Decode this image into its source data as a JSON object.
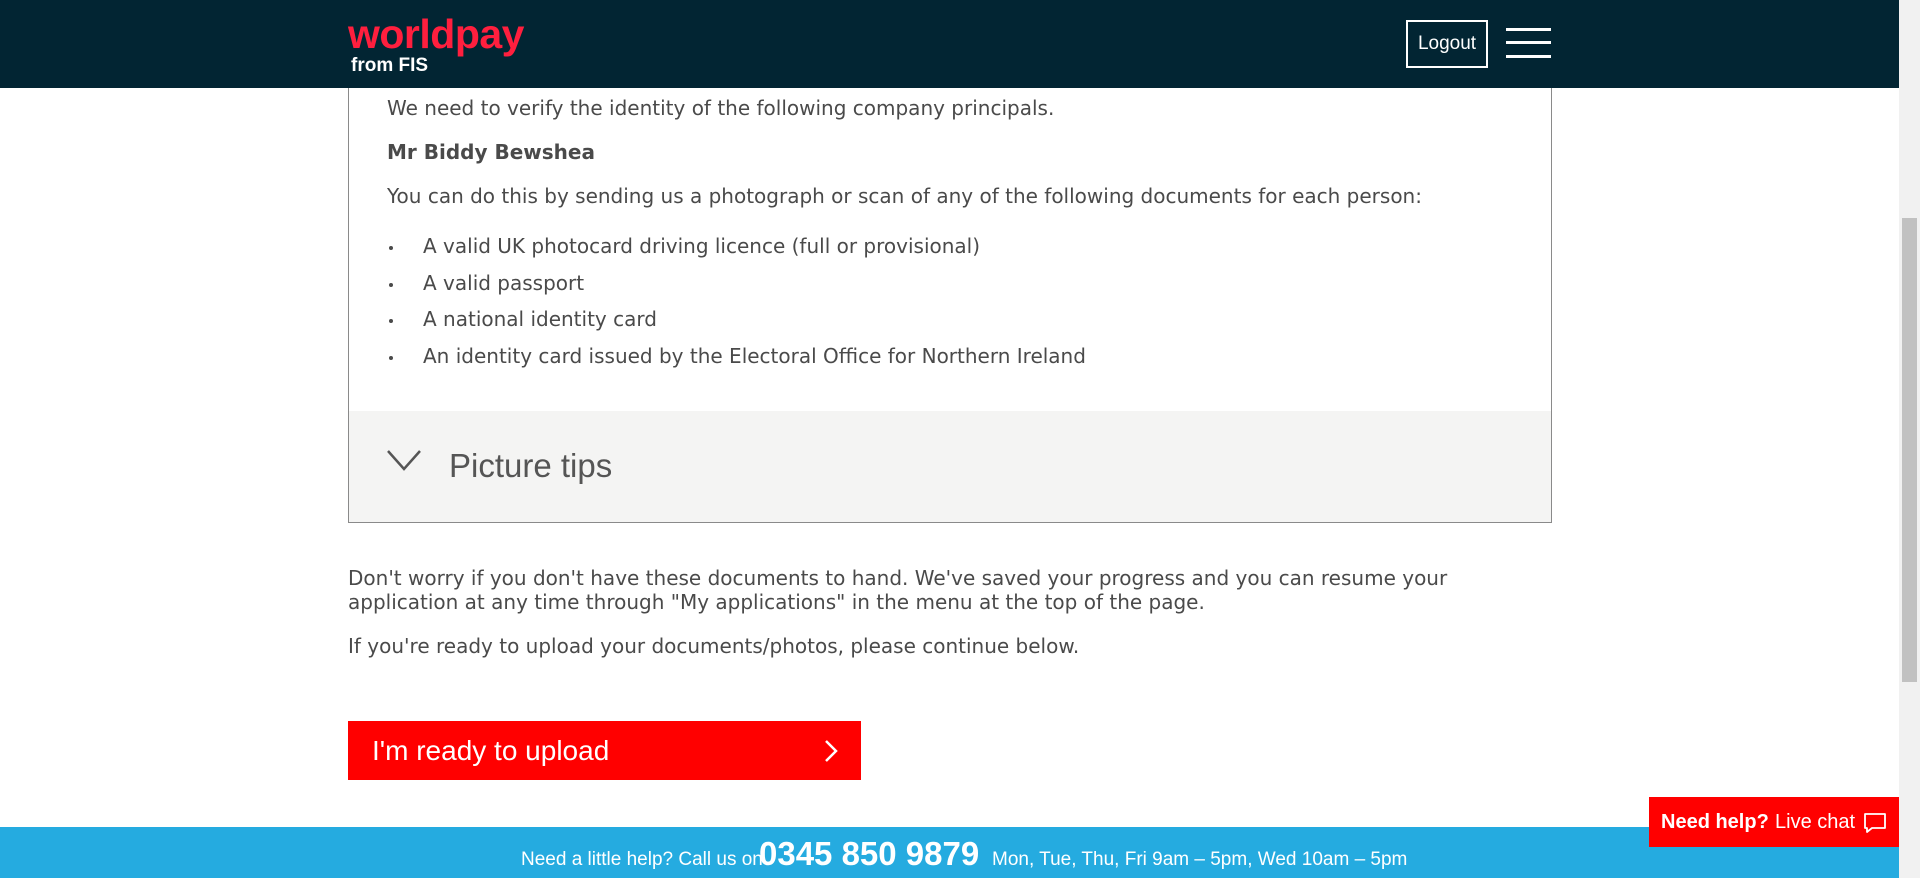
{
  "header": {
    "logo_main": "worldpay",
    "logo_sub": "from FIS",
    "logout_label": "Logout"
  },
  "verification": {
    "intro": "We need to verify the identity of the following company principals.",
    "person_name": "Mr Biddy Bewshea",
    "instruction": "You can do this by sending us a photograph or scan of any of the following documents for each person:",
    "documents": [
      "A valid UK photocard driving licence (full or provisional)",
      "A valid passport",
      "A national identity card",
      "An identity card issued by the Electoral Office for Northern Ireland"
    ],
    "tips_label": "Picture tips"
  },
  "main": {
    "note": "Don't worry if you don't have these documents to hand. We've saved your progress and you can resume your application at any time through \"My applications\" in the menu at the top of the page.",
    "ready_text": "If you're ready to upload your documents/photos, please continue below.",
    "upload_button_label": "I'm ready to upload"
  },
  "chat": {
    "strong_label": "Need help?",
    "label": "Live chat"
  },
  "help_bar": {
    "lead": "Need a little help? Call us on",
    "phone": "0345 850 9879",
    "hours": "Mon, Tue, Thu, Fri 9am – 5pm, Wed 10am – 5pm"
  },
  "colors": {
    "header_bg": "#022533",
    "brand_red": "#ff1f3e",
    "button_red": "#ff0000",
    "help_bar_blue": "#25abe0",
    "tips_bg": "#f4f4f3"
  }
}
